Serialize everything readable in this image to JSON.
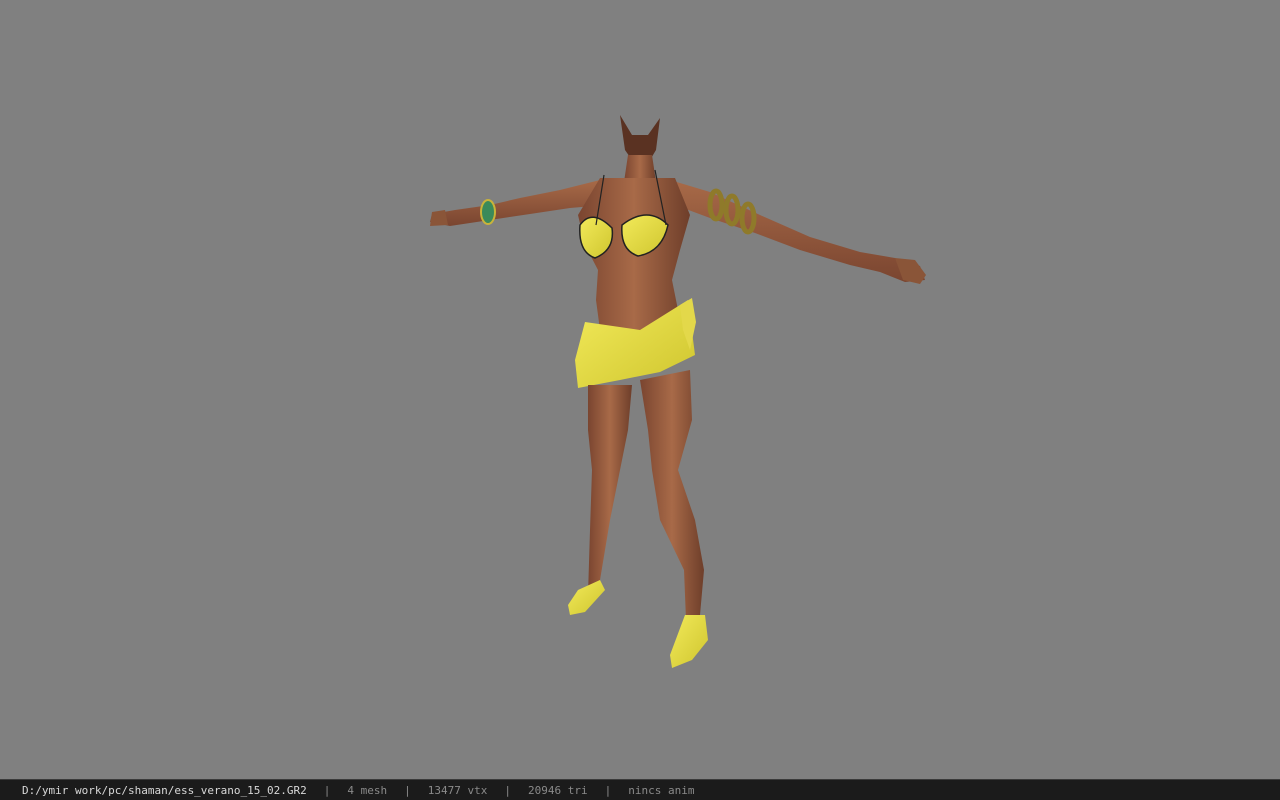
{
  "viewport": {
    "background": "#808080",
    "model": {
      "name": "shaman-character-model",
      "skin_color": "#9b5f3f",
      "outfit_color": "#e8e04a"
    }
  },
  "statusbar": {
    "file_path": "D:/ymir work/pc/shaman/ess_verano_15_02.GR2",
    "separator": "|",
    "mesh_count": "4 mesh",
    "vertex_count": "13477 vtx",
    "triangle_count": "20946 tri",
    "anim_status": "nincs anim"
  }
}
